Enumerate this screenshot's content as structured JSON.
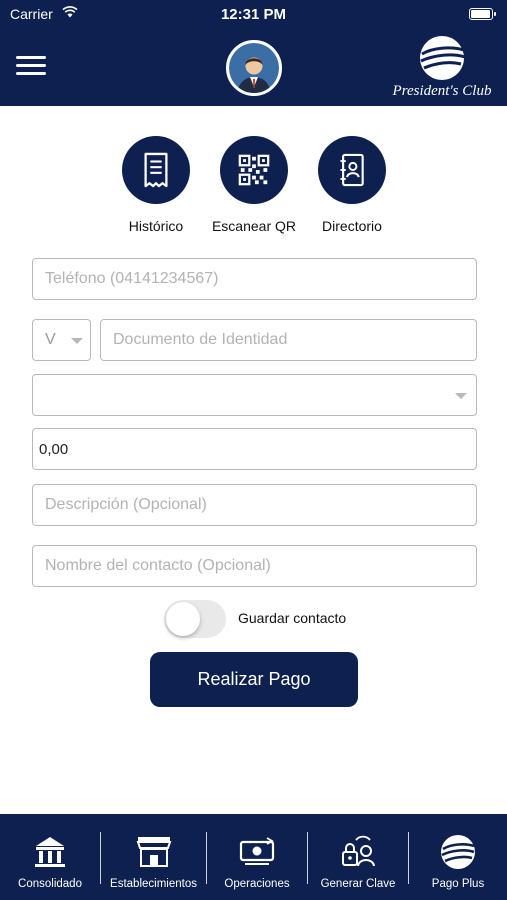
{
  "status_bar": {
    "carrier": "Carrier",
    "time": "12:31 PM",
    "battery_level": 1.0
  },
  "header": {
    "logo_text": "President's Club"
  },
  "shortcuts": [
    {
      "label": "Histórico",
      "icon": "receipt-icon"
    },
    {
      "label": "Escanear QR",
      "icon": "qr-code-icon"
    },
    {
      "label": "Directorio",
      "icon": "contacts-book-icon"
    }
  ],
  "form": {
    "phone_placeholder": "Teléfono (04141234567)",
    "doc_type_value": "V",
    "document_placeholder": "Documento de Identidad",
    "bank_select_value": "",
    "amount_value": "0,00",
    "description_placeholder": "Descripción (Opcional)",
    "contact_name_placeholder": "Nombre del contacto (Opcional)",
    "save_contact_label": "Guardar contacto",
    "save_contact_on": false,
    "pay_button_label": "Realizar Pago"
  },
  "bottom_nav": [
    {
      "label": "Consolidado",
      "icon": "bank-icon"
    },
    {
      "label": "Establecimientos",
      "icon": "storefront-icon"
    },
    {
      "label": "Operaciones",
      "icon": "cash-icon"
    },
    {
      "label": "Generar Clave",
      "icon": "key-user-icon"
    },
    {
      "label": "Pago Plus",
      "icon": "presidents-club-logo-icon"
    }
  ],
  "colors": {
    "primary": "#0d2050",
    "border": "#b9b9b9",
    "placeholder": "#b3b3b3"
  }
}
